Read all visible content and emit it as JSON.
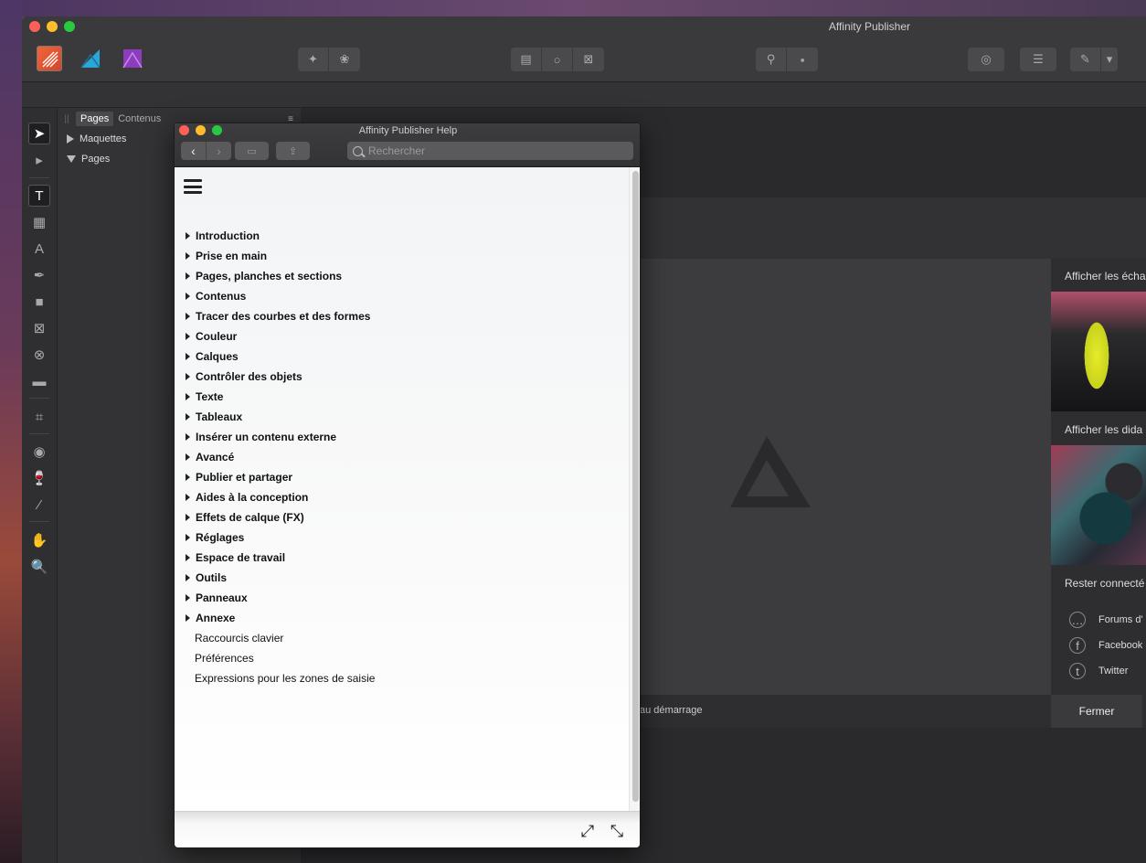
{
  "app": {
    "title": "Affinity Publisher",
    "personas": [
      "publisher-persona-icon",
      "designer-persona-icon",
      "photo-persona-icon"
    ],
    "toolbar_groups": [
      [
        "share-icon",
        "flower-icon"
      ],
      [
        "page-icon",
        "circle-icon",
        "box-icon"
      ],
      [
        "pin-icon",
        "square-icon"
      ],
      [
        "view-icon"
      ],
      [
        "lines-icon"
      ],
      [
        "brush-icon",
        "chevron-down-icon"
      ]
    ]
  },
  "tools": [
    "move-tool-icon",
    "node-tool-icon",
    "text-frame-icon",
    "table-icon",
    "artistic-text-icon",
    "pen-icon",
    "rectangle-icon",
    "picture-frame-icon",
    "ellipse-frame-icon",
    "image-icon",
    "crop-icon",
    "fill-icon",
    "transparency-icon",
    "color-picker-icon",
    "hand-icon",
    "zoom-icon"
  ],
  "panel": {
    "tabs": [
      "Pages",
      "Contenus"
    ],
    "active_tab": "Pages",
    "rows": [
      "Maquettes",
      "Pages"
    ]
  },
  "welcome": {
    "right_labels": [
      "Afficher les écha",
      "Afficher les dida",
      "Rester connecté"
    ],
    "social": [
      {
        "icon": "forum-icon",
        "label": "Forums d'"
      },
      {
        "icon": "facebook-icon",
        "label": "Facebook"
      },
      {
        "icon": "twitter-icon",
        "label": "Twitter"
      }
    ],
    "footer_text": "au démarrage",
    "close_label": "Fermer"
  },
  "help": {
    "title": "Affinity Publisher Help",
    "search_placeholder": "Rechercher",
    "sections": [
      "Introduction",
      "Prise en main",
      "Pages, planches et sections",
      "Contenus",
      "Tracer des courbes et des formes",
      "Couleur",
      "Calques",
      "Contrôler des objets",
      "Texte",
      "Tableaux",
      "Insérer un contenu externe",
      "Avancé",
      "Publier et partager",
      "Aides à la conception",
      "Effets de calque (FX)",
      "Réglages",
      "Espace de travail",
      "Outils",
      "Panneaux",
      "Annexe"
    ],
    "links": [
      "Raccourcis clavier",
      "Préférences",
      "Expressions pour les zones de saisie"
    ]
  }
}
